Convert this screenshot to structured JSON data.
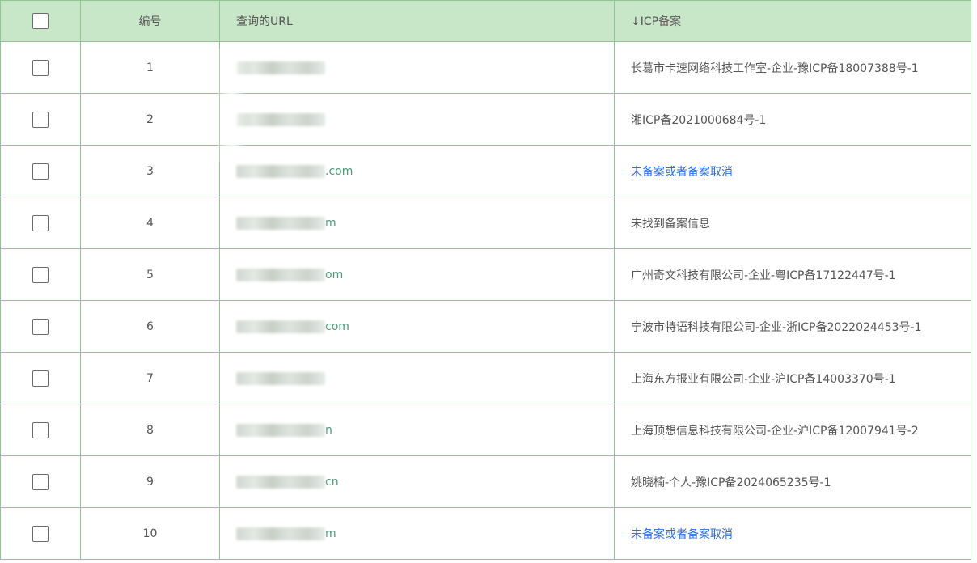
{
  "table": {
    "headers": {
      "number": "编号",
      "url": "查询的URL",
      "icp": "↓ICP备案"
    },
    "rows": [
      {
        "num": "1",
        "url_tail": "",
        "icp": "长葛市卡速网络科技工作室-企业-豫ICP备18007388号-1",
        "icp_status": "text"
      },
      {
        "num": "2",
        "url_tail": "",
        "icp": "湘ICP备2021000684号-1",
        "icp_status": "text"
      },
      {
        "num": "3",
        "url_tail": ".com",
        "icp": "未备案或者备案取消",
        "icp_status": "link"
      },
      {
        "num": "4",
        "url_tail": "m",
        "icp": "未找到备案信息",
        "icp_status": "text"
      },
      {
        "num": "5",
        "url_tail": "om",
        "icp": "广州奇文科技有限公司-企业-粤ICP备17122447号-1",
        "icp_status": "text"
      },
      {
        "num": "6",
        "url_tail": "com",
        "icp": "宁波市特语科技有限公司-企业-浙ICP备2022024453号-1",
        "icp_status": "text"
      },
      {
        "num": "7",
        "url_tail": "",
        "icp": "上海东方报业有限公司-企业-沪ICP备14003370号-1",
        "icp_status": "text"
      },
      {
        "num": "8",
        "url_tail": "n",
        "icp": "上海顶想信息科技有限公司-企业-沪ICP备12007941号-2",
        "icp_status": "text"
      },
      {
        "num": "9",
        "url_tail": "cn",
        "icp": "姚晓楠-个人-豫ICP备2024065235号-1",
        "icp_status": "text"
      },
      {
        "num": "10",
        "url_tail": "m",
        "icp": "未备案或者备案取消",
        "icp_status": "link"
      }
    ]
  },
  "colors": {
    "header_bg": "#c8e6c8",
    "border": "#8fc58f",
    "link": "#2f6fd6",
    "url_text": "#4a9a7a"
  }
}
